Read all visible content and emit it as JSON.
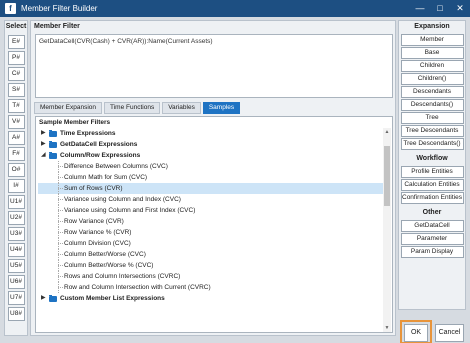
{
  "window": {
    "title": "Member Filter Builder",
    "app_icon": "f",
    "minimize_glyph": "—",
    "maximize_glyph": "□",
    "close_glyph": "✕"
  },
  "select_panel": {
    "title": "Select",
    "buttons": [
      "E#",
      "P#",
      "C#",
      "S#",
      "T#",
      "V#",
      "A#",
      "F#",
      "O#",
      "I#",
      "U1#",
      "U2#",
      "U3#",
      "U4#",
      "U5#",
      "U6#",
      "U7#",
      "U8#"
    ]
  },
  "member_filter": {
    "title": "Member Filter",
    "formula": "GetDataCell(CVR(Cash) + CVR(AR)):Name(Current Assets)"
  },
  "tabs": [
    {
      "label": "Member Expansion",
      "active": false
    },
    {
      "label": "Time Functions",
      "active": false
    },
    {
      "label": "Variables",
      "active": false
    },
    {
      "label": "Samples",
      "active": true
    }
  ],
  "samples": {
    "title": "Sample Member Filters",
    "tree": [
      {
        "type": "group",
        "label": "Time Expressions",
        "expanded": false
      },
      {
        "type": "group",
        "label": "GetDataCell Expressions",
        "expanded": false
      },
      {
        "type": "group",
        "label": "Column/Row Expressions",
        "expanded": true
      },
      {
        "type": "item",
        "label": "Difference Between Columns (CVC)"
      },
      {
        "type": "item",
        "label": "Column Math for Sum (CVC)"
      },
      {
        "type": "item",
        "label": "Sum of Rows (CVR)",
        "selected": true
      },
      {
        "type": "item",
        "label": "Variance using Column and Index (CVC)"
      },
      {
        "type": "item",
        "label": "Variance using Column and First Index (CVC)"
      },
      {
        "type": "item",
        "label": "Row Variance (CVR)"
      },
      {
        "type": "item",
        "label": "Row Variance % (CVR)"
      },
      {
        "type": "item",
        "label": "Column Division (CVC)"
      },
      {
        "type": "item",
        "label": "Column Better/Worse (CVC)"
      },
      {
        "type": "item",
        "label": "Column Better/Worse % (CVC)"
      },
      {
        "type": "item",
        "label": "Rows and Column Intersections (CVRC)"
      },
      {
        "type": "item",
        "label": "Row and Column Intersection with Current (CVRC)"
      },
      {
        "type": "group",
        "label": "Custom Member List Expressions",
        "expanded": false
      }
    ]
  },
  "right_panel": {
    "expansion": {
      "title": "Expansion",
      "buttons": [
        "Member",
        "Base",
        "Children",
        "Children()",
        "Descendants",
        "Descendants()",
        "Tree",
        "Tree Descendants",
        "Tree Descendants()"
      ]
    },
    "workflow": {
      "title": "Workflow",
      "buttons": [
        "Profile Entities",
        "Calculation Entities",
        "Confirmation Entities"
      ]
    },
    "other": {
      "title": "Other",
      "buttons": [
        "GetDataCell",
        "Parameter",
        "Param Display"
      ]
    }
  },
  "footer": {
    "ok": "OK",
    "cancel": "Cancel"
  },
  "colors": {
    "titlebar": "#1d4f82",
    "accent": "#1e73c3",
    "ok_highlight": "#e8943a",
    "selected_row": "#cde4f7"
  }
}
